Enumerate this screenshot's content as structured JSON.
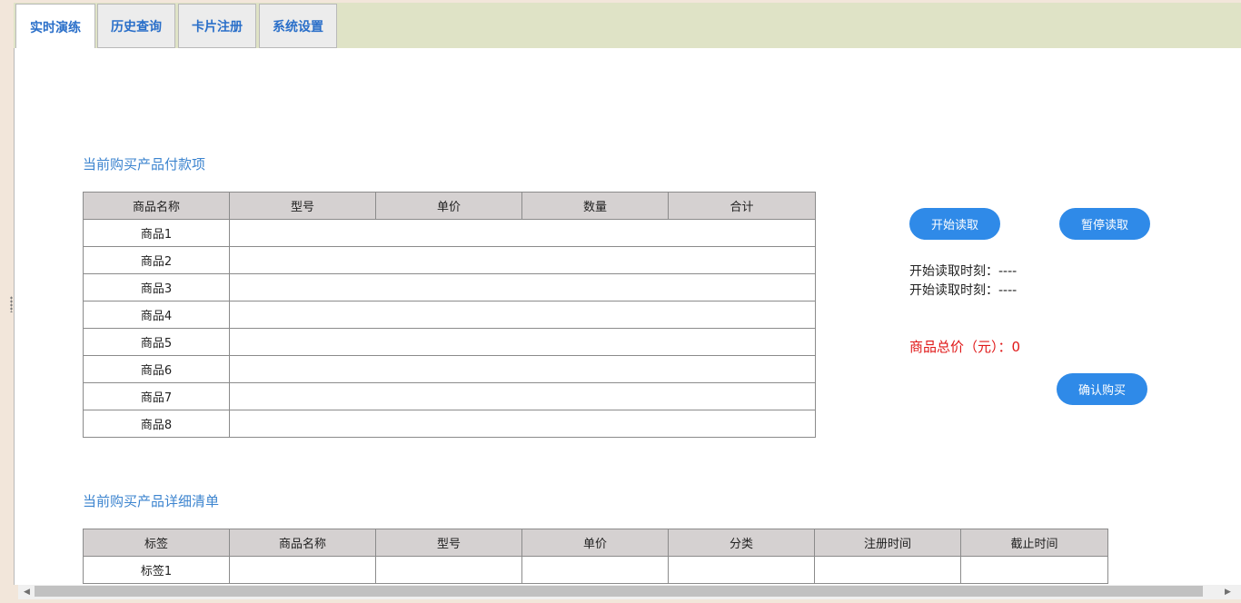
{
  "tabs": [
    "实时演练",
    "历史查询",
    "卡片注册",
    "系统设置"
  ],
  "payment": {
    "title": "当前购买产品付款项",
    "headers": [
      "商品名称",
      "型号",
      "单价",
      "数量",
      "合计"
    ],
    "rows": [
      "商品1",
      "商品2",
      "商品3",
      "商品4",
      "商品5",
      "商品6",
      "商品7",
      "商品8"
    ]
  },
  "controls": {
    "start_button": "开始读取",
    "pause_button": "暂停读取",
    "start_time_1": "开始读取时刻：----",
    "start_time_2": "开始读取时刻：----",
    "total_label": "商品总价（元）：0",
    "confirm_button": "确认购买"
  },
  "detail": {
    "title": "当前购买产品详细清单",
    "headers": [
      "标签",
      "商品名称",
      "型号",
      "单价",
      "分类",
      "注册时间",
      "截止时间"
    ],
    "rows": [
      "标签1"
    ]
  },
  "colors": {
    "accent": "#2f8ae8",
    "title": "#3c84cf",
    "total": "#e01818",
    "tabbar": "#dfe3c6"
  }
}
